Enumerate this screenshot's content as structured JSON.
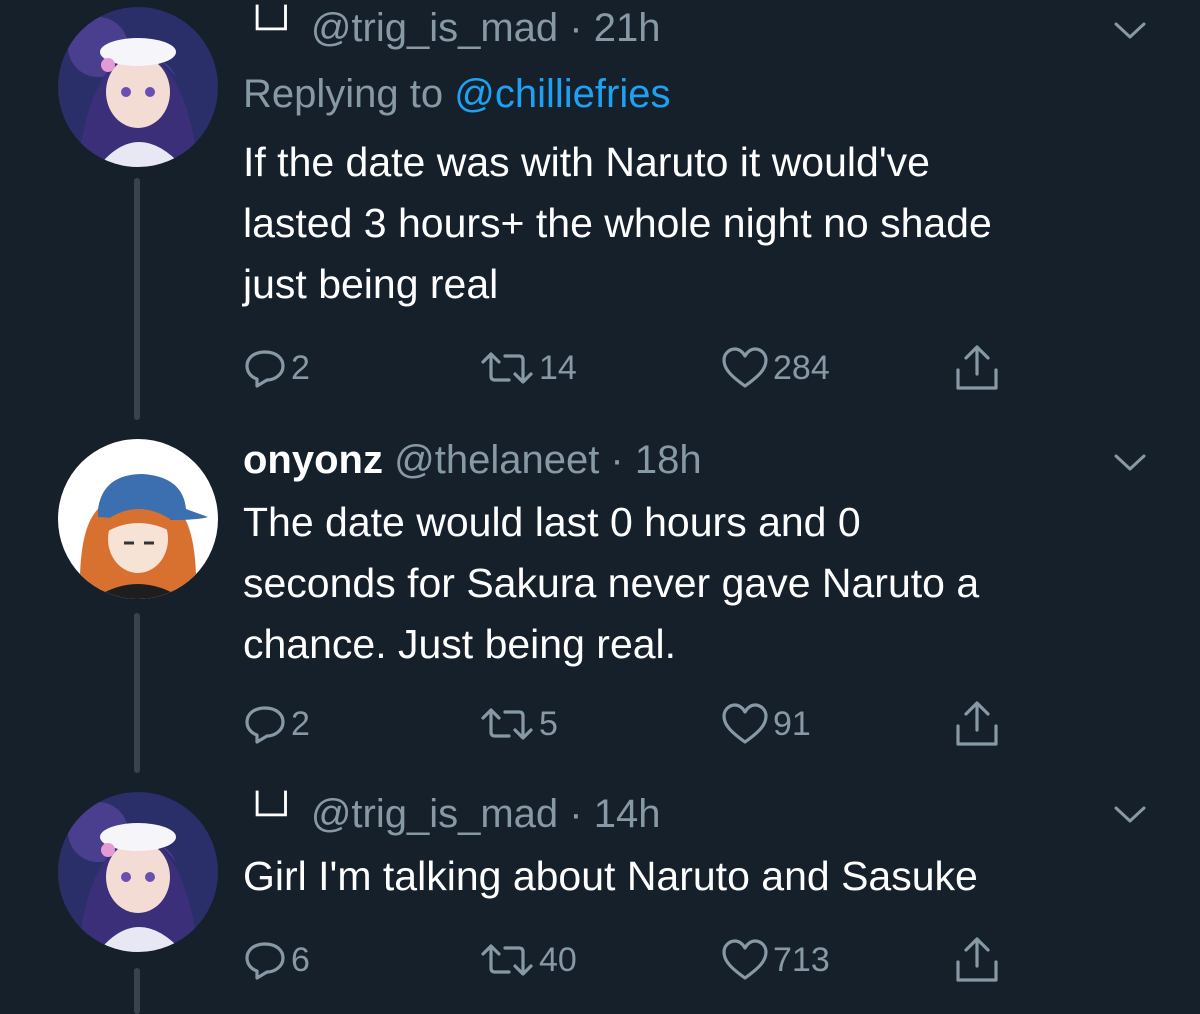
{
  "tweets": [
    {
      "display_name": "L┃",
      "name_glyph": "└┘",
      "handle": "@trig_is_mad",
      "time": "21h",
      "replying_prefix": "Replying to ",
      "replying_to": "@chilliefries",
      "text_lines": [
        "If the date was with Naruto it would've",
        "lasted 3 hours+ the whole night no shade",
        "just being real"
      ],
      "replies": "2",
      "retweets": "14",
      "likes": "284"
    },
    {
      "display_name": "onyonz",
      "handle": "@thelaneet",
      "time": "18h",
      "text_lines": [
        "The date would last 0 hours and 0",
        "seconds for Sakura never gave Naruto a",
        "chance. Just being real."
      ],
      "replies": "2",
      "retweets": "5",
      "likes": "91"
    },
    {
      "display_name": "L┃",
      "name_glyph": "└┘",
      "handle": "@trig_is_mad",
      "time": "14h",
      "text_lines": [
        "Girl I'm talking about Naruto and Sasuke"
      ],
      "replies": "6",
      "retweets": "40",
      "likes": "713"
    }
  ],
  "separator": " · ",
  "colors": {
    "background": "#15202b",
    "text": "#ffffff",
    "muted": "#8899a6",
    "link": "#1da1f2",
    "thread_line": "#38444d"
  },
  "icons": [
    "reply-icon",
    "retweet-icon",
    "like-icon",
    "share-icon",
    "chevron-down-icon"
  ]
}
